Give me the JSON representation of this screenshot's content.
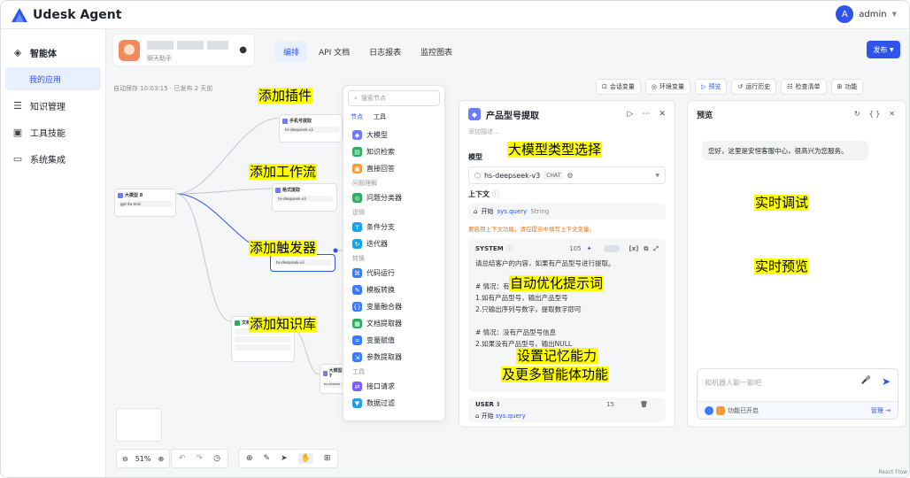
{
  "app": {
    "title": "Udesk Agent",
    "brand_color": "#2f54eb"
  },
  "user": {
    "initial": "A",
    "name": "admin"
  },
  "sidebar": {
    "items": [
      {
        "label": "智能体",
        "icon": "layers-icon"
      },
      {
        "label": "我的应用",
        "icon": ""
      },
      {
        "label": "知识管理",
        "icon": "database-icon"
      },
      {
        "label": "工具技能",
        "icon": "toolbox-icon"
      },
      {
        "label": "系统集成",
        "icon": "monitor-icon"
      }
    ]
  },
  "agent": {
    "subtitle": "聊天助手"
  },
  "tabs": [
    {
      "label": "编排"
    },
    {
      "label": "API 文档"
    },
    {
      "label": "日志报表"
    },
    {
      "label": "监控图表"
    }
  ],
  "publish_label": "发布",
  "autosave": "自动保存 10:03:15 · 已发布 2 天前",
  "toolbar": [
    "会话变量",
    "环境变量",
    "预览",
    "运行历史",
    "检查清单",
    "功能"
  ],
  "node_panel": {
    "search_placeholder": "搜索节点",
    "tabs": [
      "节点",
      "工具"
    ],
    "items": [
      {
        "label": "大模型",
        "color": "#6b7cff"
      },
      {
        "label": "知识检索",
        "color": "#27ae60"
      },
      {
        "label": "直接回答",
        "color": "#f29b38"
      },
      {
        "group": "问题理解"
      },
      {
        "label": "问题分类器",
        "color": "#27ae60"
      },
      {
        "group": "逻辑"
      },
      {
        "label": "条件分支",
        "color": "#1aa1e6"
      },
      {
        "label": "迭代器",
        "color": "#1aa1e6"
      },
      {
        "group": "转换"
      },
      {
        "label": "代码运行",
        "color": "#3a7afe"
      },
      {
        "label": "模板转换",
        "color": "#3a7afe"
      },
      {
        "label": "变量融合器",
        "color": "#3a7afe"
      },
      {
        "label": "文档提取器",
        "color": "#27ae60"
      },
      {
        "label": "变量赋值",
        "color": "#3a7afe"
      },
      {
        "label": "参数提取器",
        "color": "#3a7afe"
      },
      {
        "group": "工具"
      },
      {
        "label": "接口请求",
        "color": "#7a5cff"
      },
      {
        "label": "数据过滤",
        "color": "#1aa1e6"
      }
    ]
  },
  "config": {
    "title": "产品型号提取",
    "desc_placeholder": "添加描述...",
    "model_label": "模型",
    "model_name": "hs-deepseek-v3",
    "model_badge": "CHAT",
    "context_label": "上下文",
    "context_node": "开始",
    "context_var": "sys.query",
    "context_type": "String",
    "context_warning": "要启用上下文功能，请在提示中填写上下文变量。",
    "system_label": "SYSTEM",
    "system_count": "105",
    "system_lines": [
      "请总结客户的内容，如果有产品型号进行提取。",
      "",
      "# 情况：有",
      "1.如有产品型号，输出产品型号",
      "2.只输出序列号数字，提取数字即可",
      "",
      "# 情况：没有产品型号信息",
      "2.如果没有产品型号，输出NULL"
    ],
    "user_label": "USER",
    "user_count": "15",
    "user_node": "开始",
    "user_var": "sys.query"
  },
  "preview": {
    "title": "预览",
    "greeting": "您好，这里是安恒客服中心，很高兴为您服务。",
    "input_placeholder": "和机器人聊一聊吧",
    "feature_text": "功能已开启",
    "manage_label": "管理 →"
  },
  "zoom": "51%",
  "canvas_nodes": [
    {
      "title": "大模型 8",
      "model": "gpt-4o-mini"
    },
    {
      "title": "手机号提取",
      "model": "hs-deepseek-v3"
    },
    {
      "title": "格式提取",
      "model": "hs-deepseek-v3"
    },
    {
      "title": "",
      "model": "hs-deepseek-v3"
    },
    {
      "title": "文档检索"
    },
    {
      "title": "大模型 7",
      "model": "hs-deepse"
    }
  ],
  "annotations": [
    "添加插件",
    "添加工作流",
    "添加触发器",
    "添加知识库",
    "大模型类型选择",
    "自动优化提示词",
    "设置记忆能力",
    "及更多智能体功能",
    "实时调试",
    "实时预览"
  ],
  "footer": "React Flow"
}
